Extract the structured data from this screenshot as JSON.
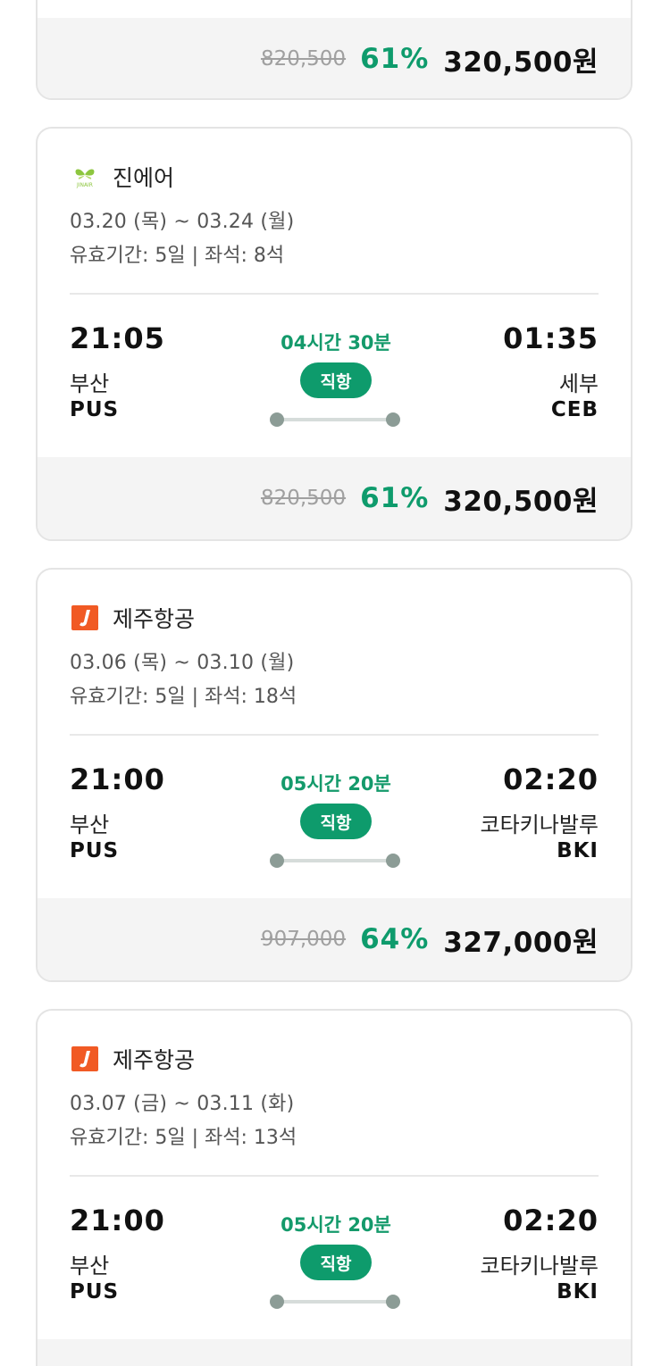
{
  "colors": {
    "accent": "#0e9b6c",
    "price_bar_bg": "#f4f4f4",
    "jinair_logo": "#8dc63f",
    "jejuair_logo": "#f15a24"
  },
  "cards": [
    {
      "price": {
        "original": "820,500",
        "discount": "61%",
        "final": "320,500원"
      }
    },
    {
      "airline": {
        "name": "진에어",
        "logo_icon": "jinair-logo-icon"
      },
      "dates": "03.20 (목) ~ 03.24 (월)",
      "meta": "유효기간: 5일 | 좌석: 8석",
      "departure": {
        "time": "21:05",
        "city": "부산",
        "code": "PUS"
      },
      "arrival": {
        "time": "01:35",
        "city": "세부",
        "code": "CEB"
      },
      "duration": "04시간 30분",
      "badge": "직항",
      "price": {
        "original": "820,500",
        "discount": "61%",
        "final": "320,500원"
      }
    },
    {
      "airline": {
        "name": "제주항공",
        "logo_icon": "jejuair-logo-icon"
      },
      "dates": "03.06 (목) ~ 03.10 (월)",
      "meta": "유효기간: 5일 | 좌석: 18석",
      "departure": {
        "time": "21:00",
        "city": "부산",
        "code": "PUS"
      },
      "arrival": {
        "time": "02:20",
        "city": "코타키나발루",
        "code": "BKI"
      },
      "duration": "05시간 20분",
      "badge": "직항",
      "price": {
        "original": "907,000",
        "discount": "64%",
        "final": "327,000원"
      }
    },
    {
      "airline": {
        "name": "제주항공",
        "logo_icon": "jejuair-logo-icon"
      },
      "dates": "03.07 (금) ~ 03.11 (화)",
      "meta": "유효기간: 5일 | 좌석: 13석",
      "departure": {
        "time": "21:00",
        "city": "부산",
        "code": "PUS"
      },
      "arrival": {
        "time": "02:20",
        "city": "코타키나발루",
        "code": "BKI"
      },
      "duration": "05시간 20분",
      "badge": "직항"
    }
  ]
}
